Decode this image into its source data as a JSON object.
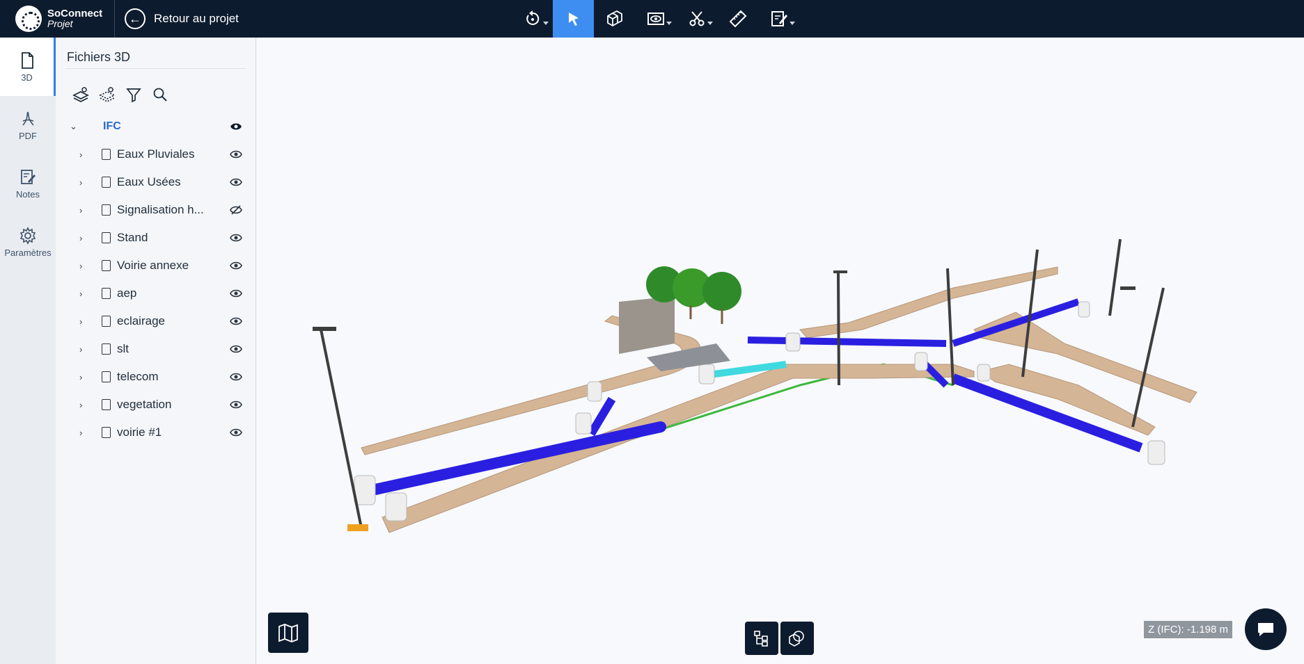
{
  "app": {
    "brand": "SoConnect",
    "sub": "Projet"
  },
  "header": {
    "back_label": "Retour au projet"
  },
  "toolbar": {
    "tools": [
      {
        "name": "rotate-icon",
        "has_menu": true
      },
      {
        "name": "select-arrow-icon",
        "active": true
      },
      {
        "name": "cubes-icon"
      },
      {
        "name": "view-mode-icon",
        "has_menu": true
      },
      {
        "name": "cut-icon",
        "has_menu": true
      },
      {
        "name": "ruler-icon"
      },
      {
        "name": "annotate-icon",
        "has_menu": true
      }
    ]
  },
  "rail": {
    "items": [
      {
        "label": "3D",
        "icon": "file-icon",
        "active": true
      },
      {
        "label": "PDF",
        "icon": "pdf-icon"
      },
      {
        "label": "Notes",
        "icon": "notes-icon"
      },
      {
        "label": "Paramètres",
        "icon": "gear-icon"
      }
    ]
  },
  "panel": {
    "title": "Fichiers 3D",
    "root": {
      "label": "IFC",
      "visible": true
    },
    "files": [
      {
        "label": "Eaux Pluviales",
        "visible": true
      },
      {
        "label": "Eaux Usées",
        "visible": true
      },
      {
        "label": "Signalisation h...",
        "visible": false
      },
      {
        "label": "Stand",
        "visible": true
      },
      {
        "label": "Voirie annexe",
        "visible": true
      },
      {
        "label": "aep",
        "visible": true
      },
      {
        "label": "eclairage",
        "visible": true
      },
      {
        "label": "slt",
        "visible": true
      },
      {
        "label": "telecom",
        "visible": true
      },
      {
        "label": "vegetation",
        "visible": true
      },
      {
        "label": "voirie #1",
        "visible": true
      }
    ]
  },
  "viewport": {
    "z_readout": "Z (IFC): -1.198 m"
  },
  "colors": {
    "topbar": "#0d1b2e",
    "accent": "#3d8ef0",
    "road": "#d2b496",
    "pipe": "#2a1fe0",
    "pipe_light": "#40d9e0",
    "tree": "#3a9a2a"
  }
}
